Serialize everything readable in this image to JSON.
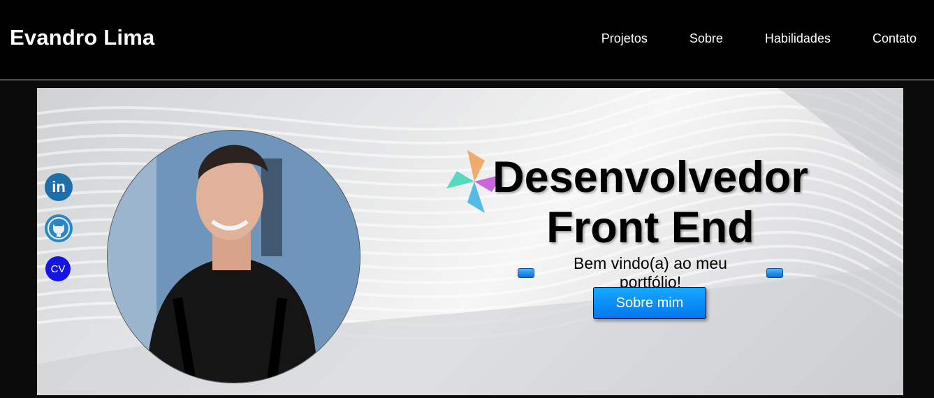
{
  "header": {
    "brand": "Evandro Lima",
    "nav": [
      "Projetos",
      "Sobre",
      "Habilidades",
      "Contato"
    ]
  },
  "hero": {
    "headline_line1": "Desenvolvedor",
    "headline_line2": "Front End",
    "welcome": "Bem vindo(a) ao meu portfólio!",
    "button": "Sobre mim"
  },
  "social": {
    "linkedin_label": "in",
    "github_icon": "github-icon",
    "cv_label": "CV"
  },
  "colors": {
    "header_bg": "#000000",
    "accent_button": "#0a8cff",
    "cv_badge": "#1414e6"
  }
}
